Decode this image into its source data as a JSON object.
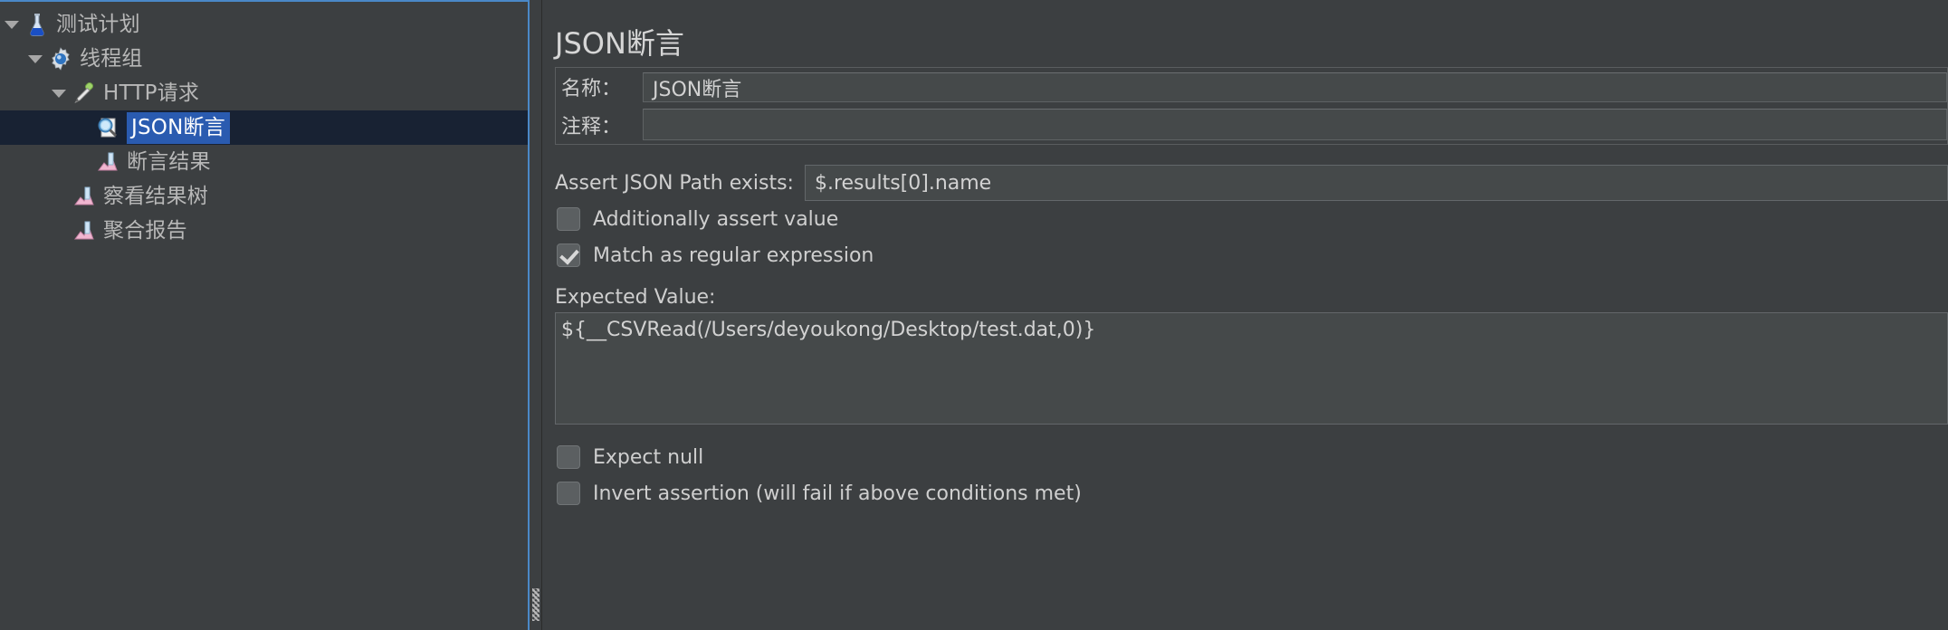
{
  "tree": {
    "items": [
      {
        "label": "测试计划",
        "icon": "flask-icon",
        "indent": 0,
        "expanded": true,
        "selected": false
      },
      {
        "label": "线程组",
        "icon": "gear-icon",
        "indent": 1,
        "expanded": true,
        "selected": false
      },
      {
        "label": "HTTP请求",
        "icon": "pipette-icon",
        "indent": 2,
        "expanded": true,
        "selected": false
      },
      {
        "label": "JSON断言",
        "icon": "magnifier-icon",
        "indent": 3,
        "expanded": false,
        "selected": true
      },
      {
        "label": "断言结果",
        "icon": "chart-listener-icon",
        "indent": 3,
        "expanded": false,
        "selected": false
      },
      {
        "label": "察看结果树",
        "icon": "chart-listener-icon",
        "indent": 2,
        "expanded": false,
        "selected": false
      },
      {
        "label": "聚合报告",
        "icon": "chart-listener-icon",
        "indent": 2,
        "expanded": false,
        "selected": false
      }
    ]
  },
  "panel": {
    "title": "JSON断言",
    "name_label": "名称：",
    "name_value": "JSON断言",
    "comment_label": "注释：",
    "comment_value": "",
    "jsonpath_label": "Assert JSON Path exists:",
    "jsonpath_value": "$.results[0].name",
    "additionally_assert_label": "Additionally assert value",
    "additionally_assert_checked": false,
    "match_regex_label": "Match as regular expression",
    "match_regex_checked": true,
    "expected_value_label": "Expected Value:",
    "expected_value": "${__CSVRead(/Users/deyoukong/Desktop/test.dat,0)}",
    "expect_null_label": "Expect null",
    "expect_null_checked": false,
    "invert_label": "Invert assertion (will fail if above conditions met)",
    "invert_checked": false
  },
  "colors": {
    "background": "#3c3f41",
    "focus_border": "#4a88c7",
    "selection_row": "#182233",
    "selection_label": "#2a5bb0",
    "field_background": "#45494a",
    "text": "#cfcfcf"
  }
}
